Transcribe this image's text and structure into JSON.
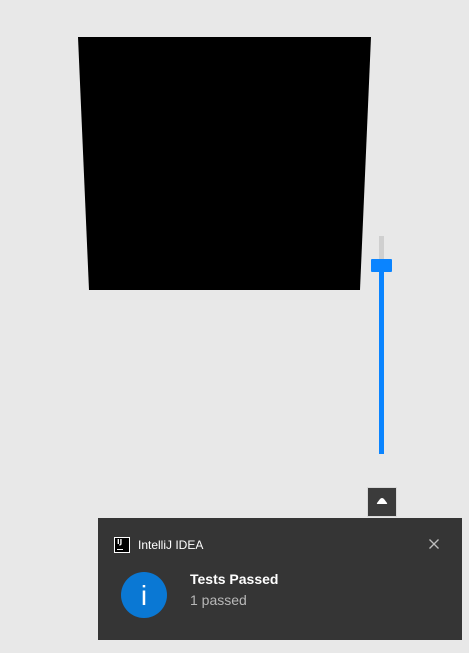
{
  "colors": {
    "background": "#e8e8e8",
    "shape": "#000000",
    "slider_accent": "#0a84ff",
    "slider_track": "#cfcfcf",
    "toast_background": "#353535",
    "info_icon": "#0a78d4"
  },
  "volume_slider": {
    "level_percent": 89
  },
  "eject_button": {
    "icon": "eject-icon"
  },
  "notification": {
    "app_icon": "intellij-idea-icon",
    "app_icon_text": "IJ",
    "app_name": "IntelliJ IDEA",
    "close_icon": "close-icon",
    "status_icon": "info-icon",
    "status_glyph": "i",
    "title": "Tests Passed",
    "message": "1 passed"
  }
}
